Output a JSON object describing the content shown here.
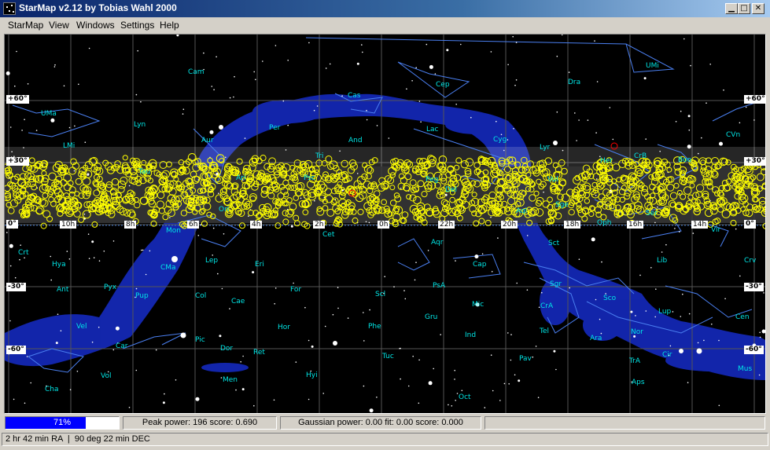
{
  "window": {
    "title": "StarMap v2.12 by Tobias Wahl 2000",
    "controls": [
      "0",
      "1",
      "r"
    ]
  },
  "menu": [
    "StarMap",
    "View",
    "Windows",
    "Settings",
    "Help"
  ],
  "map": {
    "dec_labels": [
      "+60°",
      "+30°",
      "0°",
      "-30°",
      "-60°"
    ],
    "ra_labels": [
      "10h",
      "8h",
      "6h",
      "4h",
      "2h",
      "0h",
      "22h",
      "20h",
      "18h",
      "16h",
      "14h"
    ],
    "constellations": [
      "Cam",
      "UMa",
      "Lyn",
      "LMi",
      "Aur",
      "Per",
      "Cas",
      "Cep",
      "Dra",
      "UMi",
      "Lac",
      "And",
      "Tri",
      "Cyg",
      "Lyr",
      "Her",
      "CrB",
      "Boo",
      "CVn",
      "Tau",
      "Ari",
      "Psc",
      "Peg",
      "Del",
      "Aql",
      "Ser",
      "Oph",
      "Sge",
      "Vul",
      "Mon",
      "Ori",
      "CMa",
      "Lep",
      "Eri",
      "Cet",
      "Aqr",
      "Cap",
      "Sct",
      "Lib",
      "Crt",
      "Hya",
      "Ant",
      "Pyx",
      "Pup",
      "Col",
      "Cae",
      "For",
      "Scl",
      "PsA",
      "Mic",
      "Sgr",
      "CrA",
      "Sco",
      "Lup",
      "Cen",
      "Crv",
      "Vir",
      "Vel",
      "Car",
      "Pic",
      "Dor",
      "Hor",
      "Ret",
      "Phe",
      "Gru",
      "Tuc",
      "Ind",
      "Pav",
      "Tel",
      "Ara",
      "Nor",
      "TrA",
      "Cir",
      "Mus",
      "Aps",
      "Oct",
      "Men",
      "Hyi",
      "Cha",
      "Vol"
    ]
  },
  "status": {
    "progress": 0.71,
    "progress_text": "71%",
    "peak": "Peak power: 196 score: 0.690",
    "gaussian": "Gaussian power: 0.00 fit: 0.00 score: 0.000"
  },
  "coords": {
    "ra": "2 hr 42 min RA",
    "dec": "90 deg 22 min DEC"
  },
  "colors": {
    "milky_way": "#1428b4",
    "constellation_label": "#00e5e5",
    "progress": "#0000ff",
    "title_start": "#0a246a",
    "markers": "#ffff00"
  }
}
